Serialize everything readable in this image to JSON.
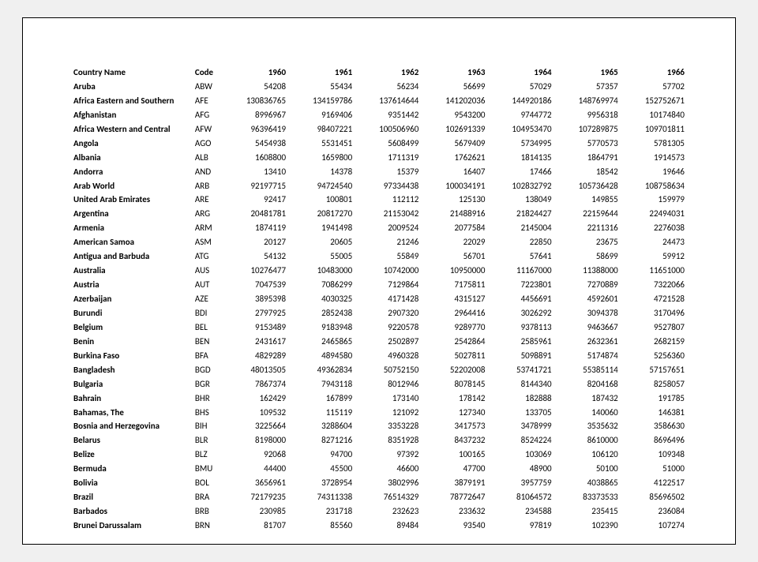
{
  "table": {
    "headers": {
      "name": "Country Name",
      "code": "Code",
      "years": [
        "1960",
        "1961",
        "1962",
        "1963",
        "1964",
        "1965",
        "1966"
      ]
    },
    "rows": [
      {
        "name": "Aruba",
        "code": "ABW",
        "values": [
          "54208",
          "55434",
          "56234",
          "56699",
          "57029",
          "57357",
          "57702"
        ]
      },
      {
        "name": "Africa Eastern and Southern",
        "code": "AFE",
        "values": [
          "130836765",
          "134159786",
          "137614644",
          "141202036",
          "144920186",
          "148769974",
          "152752671"
        ]
      },
      {
        "name": "Afghanistan",
        "code": "AFG",
        "values": [
          "8996967",
          "9169406",
          "9351442",
          "9543200",
          "9744772",
          "9956318",
          "10174840"
        ]
      },
      {
        "name": "Africa Western and Central",
        "code": "AFW",
        "values": [
          "96396419",
          "98407221",
          "100506960",
          "102691339",
          "104953470",
          "107289875",
          "109701811"
        ]
      },
      {
        "name": "Angola",
        "code": "AGO",
        "values": [
          "5454938",
          "5531451",
          "5608499",
          "5679409",
          "5734995",
          "5770573",
          "5781305"
        ]
      },
      {
        "name": "Albania",
        "code": "ALB",
        "values": [
          "1608800",
          "1659800",
          "1711319",
          "1762621",
          "1814135",
          "1864791",
          "1914573"
        ]
      },
      {
        "name": "Andorra",
        "code": "AND",
        "values": [
          "13410",
          "14378",
          "15379",
          "16407",
          "17466",
          "18542",
          "19646"
        ]
      },
      {
        "name": "Arab World",
        "code": "ARB",
        "values": [
          "92197715",
          "94724540",
          "97334438",
          "100034191",
          "102832792",
          "105736428",
          "108758634"
        ]
      },
      {
        "name": "United Arab Emirates",
        "code": "ARE",
        "values": [
          "92417",
          "100801",
          "112112",
          "125130",
          "138049",
          "149855",
          "159979"
        ]
      },
      {
        "name": "Argentina",
        "code": "ARG",
        "values": [
          "20481781",
          "20817270",
          "21153042",
          "21488916",
          "21824427",
          "22159644",
          "22494031"
        ]
      },
      {
        "name": "Armenia",
        "code": "ARM",
        "values": [
          "1874119",
          "1941498",
          "2009524",
          "2077584",
          "2145004",
          "2211316",
          "2276038"
        ]
      },
      {
        "name": "American Samoa",
        "code": "ASM",
        "values": [
          "20127",
          "20605",
          "21246",
          "22029",
          "22850",
          "23675",
          "24473"
        ]
      },
      {
        "name": "Antigua and Barbuda",
        "code": "ATG",
        "values": [
          "54132",
          "55005",
          "55849",
          "56701",
          "57641",
          "58699",
          "59912"
        ]
      },
      {
        "name": "Australia",
        "code": "AUS",
        "values": [
          "10276477",
          "10483000",
          "10742000",
          "10950000",
          "11167000",
          "11388000",
          "11651000"
        ]
      },
      {
        "name": "Austria",
        "code": "AUT",
        "values": [
          "7047539",
          "7086299",
          "7129864",
          "7175811",
          "7223801",
          "7270889",
          "7322066"
        ]
      },
      {
        "name": "Azerbaijan",
        "code": "AZE",
        "values": [
          "3895398",
          "4030325",
          "4171428",
          "4315127",
          "4456691",
          "4592601",
          "4721528"
        ]
      },
      {
        "name": "Burundi",
        "code": "BDI",
        "values": [
          "2797925",
          "2852438",
          "2907320",
          "2964416",
          "3026292",
          "3094378",
          "3170496"
        ]
      },
      {
        "name": "Belgium",
        "code": "BEL",
        "values": [
          "9153489",
          "9183948",
          "9220578",
          "9289770",
          "9378113",
          "9463667",
          "9527807"
        ]
      },
      {
        "name": "Benin",
        "code": "BEN",
        "values": [
          "2431617",
          "2465865",
          "2502897",
          "2542864",
          "2585961",
          "2632361",
          "2682159"
        ]
      },
      {
        "name": "Burkina Faso",
        "code": "BFA",
        "values": [
          "4829289",
          "4894580",
          "4960328",
          "5027811",
          "5098891",
          "5174874",
          "5256360"
        ]
      },
      {
        "name": "Bangladesh",
        "code": "BGD",
        "values": [
          "48013505",
          "49362834",
          "50752150",
          "52202008",
          "53741721",
          "55385114",
          "57157651"
        ]
      },
      {
        "name": "Bulgaria",
        "code": "BGR",
        "values": [
          "7867374",
          "7943118",
          "8012946",
          "8078145",
          "8144340",
          "8204168",
          "8258057"
        ]
      },
      {
        "name": "Bahrain",
        "code": "BHR",
        "values": [
          "162429",
          "167899",
          "173140",
          "178142",
          "182888",
          "187432",
          "191785"
        ]
      },
      {
        "name": "Bahamas, The",
        "code": "BHS",
        "values": [
          "109532",
          "115119",
          "121092",
          "127340",
          "133705",
          "140060",
          "146381"
        ]
      },
      {
        "name": "Bosnia and Herzegovina",
        "code": "BIH",
        "values": [
          "3225664",
          "3288604",
          "3353228",
          "3417573",
          "3478999",
          "3535632",
          "3586630"
        ]
      },
      {
        "name": "Belarus",
        "code": "BLR",
        "values": [
          "8198000",
          "8271216",
          "8351928",
          "8437232",
          "8524224",
          "8610000",
          "8696496"
        ]
      },
      {
        "name": "Belize",
        "code": "BLZ",
        "values": [
          "92068",
          "94700",
          "97392",
          "100165",
          "103069",
          "106120",
          "109348"
        ]
      },
      {
        "name": "Bermuda",
        "code": "BMU",
        "values": [
          "44400",
          "45500",
          "46600",
          "47700",
          "48900",
          "50100",
          "51000"
        ]
      },
      {
        "name": "Bolivia",
        "code": "BOL",
        "values": [
          "3656961",
          "3728954",
          "3802996",
          "3879191",
          "3957759",
          "4038865",
          "4122517"
        ]
      },
      {
        "name": "Brazil",
        "code": "BRA",
        "values": [
          "72179235",
          "74311338",
          "76514329",
          "78772647",
          "81064572",
          "83373533",
          "85696502"
        ]
      },
      {
        "name": "Barbados",
        "code": "BRB",
        "values": [
          "230985",
          "231718",
          "232623",
          "233632",
          "234588",
          "235415",
          "236084"
        ]
      },
      {
        "name": "Brunei Darussalam",
        "code": "BRN",
        "values": [
          "81707",
          "85560",
          "89484",
          "93540",
          "97819",
          "102390",
          "107274"
        ]
      }
    ]
  }
}
